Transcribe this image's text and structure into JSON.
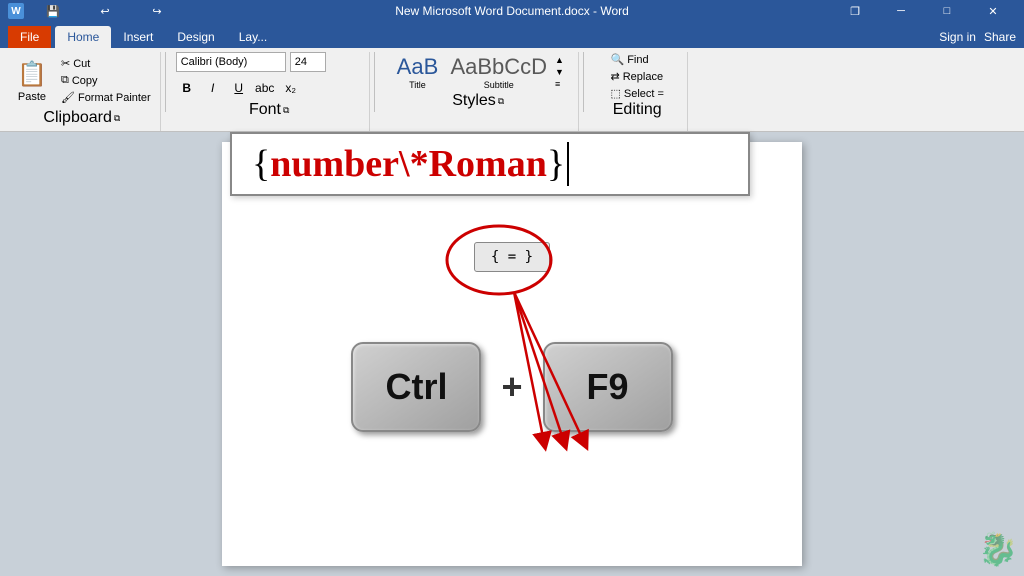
{
  "titlebar": {
    "title": "New Microsoft Word Document.docx - Word",
    "save_icon": "💾",
    "undo_icon": "↩",
    "redo_icon": "↪",
    "min_btn": "─",
    "max_btn": "□",
    "close_btn": "✕",
    "restore_btn": "❐"
  },
  "ribbon_tabs": {
    "file": "File",
    "home": "Home",
    "insert": "Insert",
    "design": "Design",
    "layout": "Lay...",
    "sign_in": "Sign in",
    "share": "Share"
  },
  "clipboard": {
    "paste_label": "Paste",
    "cut_label": "Cut",
    "copy_label": "Copy",
    "format_painter_label": "Format Painter",
    "group_label": "Clipboard"
  },
  "font": {
    "font_name": "Calibri (Body)",
    "font_size": "24",
    "bold": "B",
    "italic": "I",
    "underline": "U",
    "strikethrough": "abc",
    "subscript": "x₂",
    "group_label": "Font"
  },
  "styles": {
    "title_label": "Title",
    "subtitle_label": "Subtitle",
    "group_label": "Styles"
  },
  "editing": {
    "find_label": "Find",
    "replace_label": "Replace",
    "select_label": "Select =",
    "group_label": "Editing"
  },
  "formula": {
    "brace_open": "{ ",
    "equals": "=",
    "field_text": "number\\*Roman",
    "brace_close": " }"
  },
  "field_code": {
    "text": "{ = }"
  },
  "keys": {
    "ctrl": "Ctrl",
    "plus": "+",
    "f9": "F9"
  },
  "watermark": "🐉"
}
